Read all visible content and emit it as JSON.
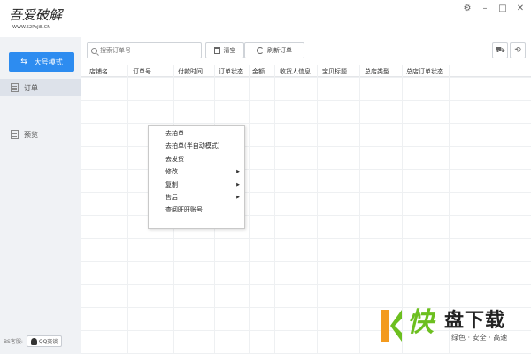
{
  "app": {
    "logo_main": "吾爱破解",
    "logo_sub": "WWW.52PoJiE.CN"
  },
  "window_controls": [
    {
      "icon": "gear-icon",
      "glyph": "⚙"
    },
    {
      "icon": "minimize-icon",
      "glyph": "–"
    },
    {
      "icon": "maximize-icon",
      "glyph": "□"
    },
    {
      "icon": "close-icon",
      "glyph": "✕"
    }
  ],
  "sidebar": {
    "mode_button": "大号模式",
    "items": [
      {
        "label": "订单",
        "icon": "orders-icon",
        "active": true
      },
      {
        "label": "预览",
        "icon": "preview-icon",
        "active": false
      }
    ],
    "footer_label": "BS客服:",
    "qq_button": "QQ交谈"
  },
  "toolbar": {
    "search_placeholder": "搜索订单号",
    "clear_label": "清空",
    "refresh_label": "刷新订单",
    "right_icons": [
      "shipping-icon",
      "history-icon"
    ]
  },
  "table": {
    "columns": [
      "店铺名",
      "订单号",
      "付款时间",
      "订单状态",
      "金额",
      "收货人信息",
      "宝贝标题",
      "总店类型",
      "总店订单状态"
    ],
    "rows": []
  },
  "context_menu": {
    "items": [
      {
        "label": "去拍单",
        "submenu": false
      },
      {
        "label": "去拍单(半自动模式)",
        "submenu": false
      },
      {
        "label": "去发货",
        "submenu": false
      },
      {
        "label": "修改",
        "submenu": true
      },
      {
        "label": "复制",
        "submenu": true
      },
      {
        "label": "售后",
        "submenu": true
      },
      {
        "label": "查阅旺旺账号",
        "submenu": false
      }
    ],
    "arrow_glyph": "▶"
  },
  "watermark": {
    "kuai": "快",
    "title": "盘下载",
    "tagline": "绿色 · 安全 · 高速",
    "colors": {
      "green": "#6cbf1f",
      "orange": "#f39a1e"
    }
  },
  "colors": {
    "accent": "#2d8cf0",
    "sidebar_bg": "#f0f2f5",
    "sidebar_active": "#dde2ea"
  }
}
